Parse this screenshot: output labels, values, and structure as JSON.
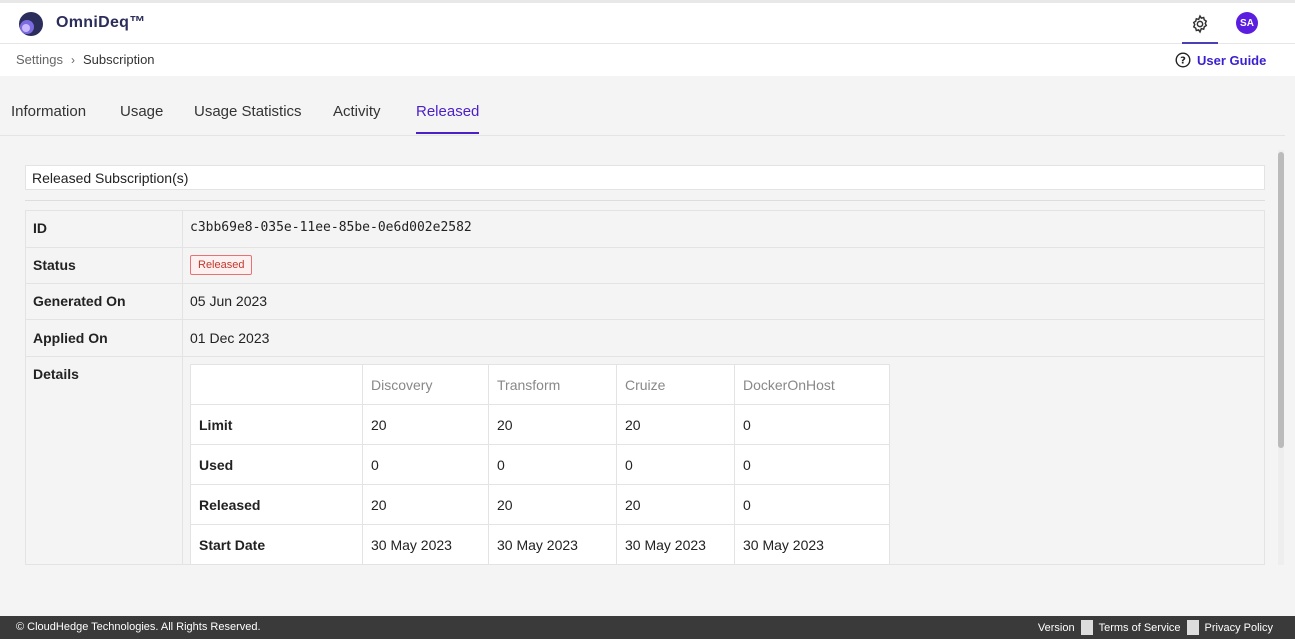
{
  "app": {
    "name": "OmniDeq™",
    "user_initials": "SA",
    "accent": "#4a1fc7"
  },
  "breadcrumb": {
    "parent": "Settings",
    "current": "Subscription"
  },
  "help": {
    "label": "User Guide"
  },
  "tabs": [
    "Information",
    "Usage",
    "Usage Statistics",
    "Activity",
    "Released"
  ],
  "active_tab": "Released",
  "section_title": "Released Subscription(s)",
  "info": {
    "id_label": "ID",
    "id_value": "c3bb69e8-035e-11ee-85be-0e6d002e2582",
    "status_label": "Status",
    "status_value": "Released",
    "generated_label": "Generated On",
    "generated_value": "05 Jun 2023",
    "applied_label": "Applied On",
    "applied_value": "01 Dec 2023",
    "details_label": "Details"
  },
  "details_table": {
    "columns": [
      "Discovery",
      "Transform",
      "Cruize",
      "DockerOnHost"
    ],
    "rows": [
      {
        "label": "Limit",
        "cells": [
          "20",
          "20",
          "20",
          "0"
        ]
      },
      {
        "label": "Used",
        "cells": [
          "0",
          "0",
          "0",
          "0"
        ]
      },
      {
        "label": "Released",
        "cells": [
          "20",
          "20",
          "20",
          "0"
        ]
      },
      {
        "label": "Start Date",
        "cells": [
          "30 May 2023",
          "30 May 2023",
          "30 May 2023",
          "30 May 2023"
        ]
      }
    ]
  },
  "footer": {
    "copyright": "© CloudHedge Technologies. All Rights Reserved.",
    "links": [
      "Version",
      "Terms of Service",
      "Privacy Policy"
    ]
  }
}
